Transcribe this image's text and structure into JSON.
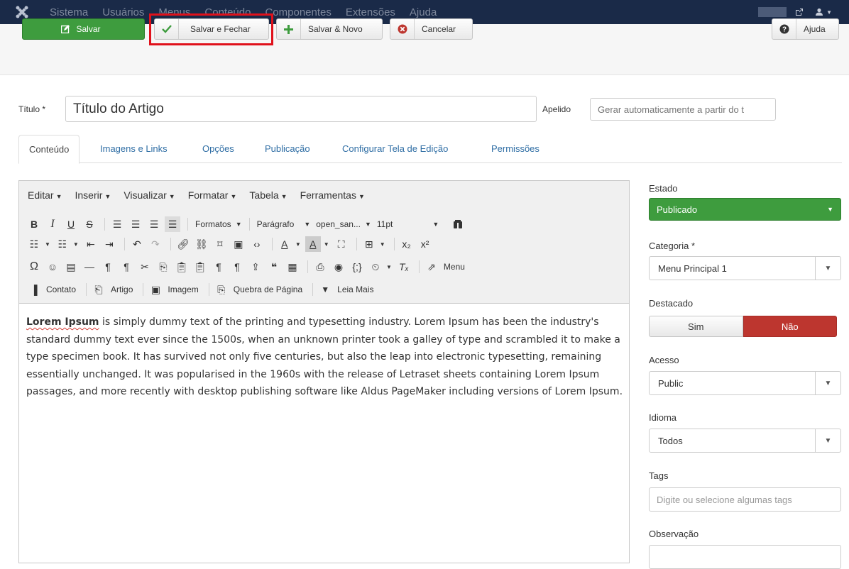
{
  "navbar": {
    "items": [
      "Sistema",
      "Usuários",
      "Menus",
      "Conteúdo",
      "Componentes",
      "Extensões",
      "Ajuda"
    ]
  },
  "toolbar": {
    "save_label": "Salvar",
    "save_close_label": "Salvar e Fechar",
    "save_new_label": "Salvar & Novo",
    "cancel_label": "Cancelar",
    "help_label": "Ajuda"
  },
  "form": {
    "title_label": "Título *",
    "title_value": "Título do Artigo",
    "alias_label": "Apelido",
    "alias_placeholder": "Gerar automaticamente a partir do t"
  },
  "tabs": [
    "Conteúdo",
    "Imagens e Links",
    "Opções",
    "Publicação",
    "Configurar Tela de Edição",
    "Permissões"
  ],
  "editor": {
    "menus": [
      "Editar",
      "Inserir",
      "Visualizar",
      "Formatar",
      "Tabela",
      "Ferramentas"
    ],
    "formats_label": "Formatos",
    "paragraph_label": "Parágrafo",
    "font_label": "open_san...",
    "size_label": "11pt",
    "menu_label": "Menu",
    "buttons": {
      "contact": "Contato",
      "article": "Artigo",
      "image": "Imagem",
      "pagebreak": "Quebra de Página",
      "readmore": "Leia Mais"
    },
    "content": "is simply dummy text of the printing and typesetting industry. Lorem Ipsum has been the industry's standard dummy text ever since the 1500s, when an unknown printer took a galley of type and scrambled it to make a type specimen book. It has survived not only five centuries, but also the leap into electronic typesetting, remaining essentially unchanged. It was popularised in the 1960s with the release of Letraset sheets containing Lorem Ipsum passages, and more recently with desktop publishing software like Aldus PageMaker including versions of Lorem Ipsum.",
    "content_bold": "Lorem Ipsum"
  },
  "sidebar": {
    "state_label": "Estado",
    "state_value": "Publicado",
    "category_label": "Categoria *",
    "category_value": "Menu Principal 1",
    "featured_label": "Destacado",
    "featured_yes": "Sim",
    "featured_no": "Não",
    "access_label": "Acesso",
    "access_value": "Public",
    "language_label": "Idioma",
    "language_value": "Todos",
    "tags_label": "Tags",
    "tags_placeholder": "Digite ou selecione algumas tags",
    "note_label": "Observação"
  }
}
